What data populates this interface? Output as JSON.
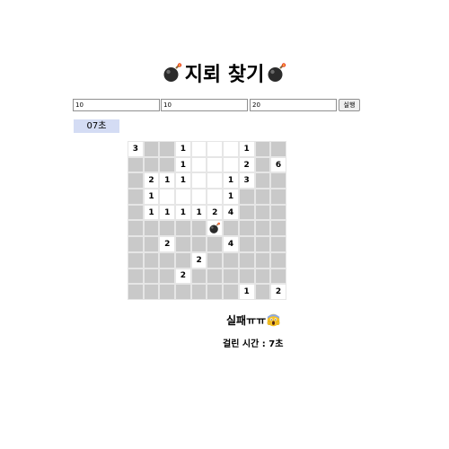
{
  "title": "지뢰 찾기",
  "controls": {
    "rows_value": "10",
    "cols_value": "10",
    "mines_value": "20",
    "run_label": "실행"
  },
  "timer": "07초",
  "board": {
    "rows": 10,
    "cols": 10,
    "cells": [
      [
        "3",
        "",
        "",
        "1",
        "",
        "",
        "",
        "1",
        "",
        ""
      ],
      [
        "",
        "",
        "",
        "1",
        "",
        "",
        "",
        "2",
        "",
        "6"
      ],
      [
        "",
        "2",
        "1",
        "1",
        "",
        "",
        "1",
        "3",
        "",
        ""
      ],
      [
        "",
        "1",
        "",
        "",
        "",
        "",
        "1",
        "",
        "",
        ""
      ],
      [
        "",
        "1",
        "1",
        "1",
        "1",
        "2",
        "4",
        "",
        "",
        ""
      ],
      [
        "",
        "",
        "",
        "",
        "",
        "*",
        "",
        "",
        "",
        ""
      ],
      [
        "",
        "",
        "2",
        "",
        "",
        "",
        "4",
        "",
        "",
        ""
      ],
      [
        "",
        "",
        "",
        "",
        "2",
        "",
        "",
        "",
        "",
        ""
      ],
      [
        "",
        "",
        "",
        "2",
        "",
        "",
        "",
        "",
        "",
        ""
      ],
      [
        "",
        "",
        "",
        "",
        "",
        "",
        "",
        "1",
        "",
        "2"
      ]
    ],
    "open": [
      [
        1,
        0,
        0,
        1,
        1,
        1,
        1,
        1,
        0,
        0
      ],
      [
        0,
        0,
        0,
        1,
        1,
        1,
        1,
        1,
        0,
        1
      ],
      [
        0,
        1,
        1,
        1,
        1,
        1,
        1,
        1,
        0,
        0
      ],
      [
        0,
        1,
        1,
        1,
        1,
        1,
        1,
        0,
        0,
        0
      ],
      [
        0,
        1,
        1,
        1,
        1,
        1,
        1,
        0,
        0,
        0
      ],
      [
        0,
        0,
        0,
        0,
        0,
        1,
        0,
        0,
        0,
        0
      ],
      [
        0,
        0,
        1,
        0,
        0,
        0,
        1,
        0,
        0,
        0
      ],
      [
        0,
        0,
        0,
        0,
        1,
        0,
        0,
        0,
        0,
        0
      ],
      [
        0,
        0,
        0,
        1,
        0,
        0,
        0,
        0,
        0,
        0
      ],
      [
        0,
        0,
        0,
        0,
        0,
        0,
        0,
        1,
        0,
        1
      ]
    ]
  },
  "result_text": "실패ㅠㅠ",
  "elapsed_text": "걸린 시간 : 7초",
  "colors": {
    "closed_cell": "#c9c9c9",
    "open_cell": "#ffffff",
    "timer_bg": "#d4dcf4"
  }
}
